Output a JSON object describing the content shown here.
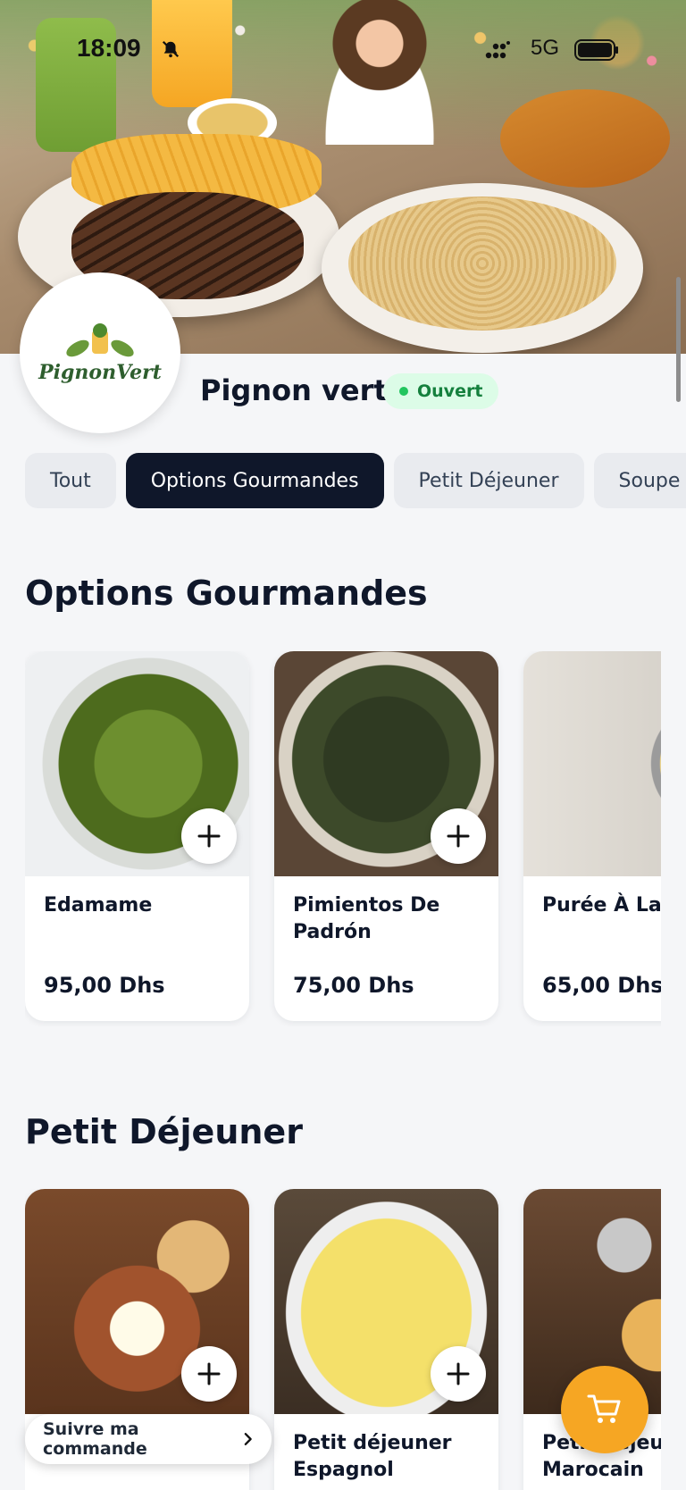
{
  "status_bar": {
    "time": "18:09",
    "network": "5G",
    "icons": [
      "bell-muted-icon",
      "signal-icon",
      "battery-icon"
    ]
  },
  "restaurant": {
    "logo_text": "PignonVert",
    "name": "Pignon vert",
    "status": "Ouvert",
    "status_color": "#22c55e"
  },
  "tabs": [
    {
      "label": "Tout",
      "active": false
    },
    {
      "label": "Options Gourmandes",
      "active": true
    },
    {
      "label": "Petit Déjeuner",
      "active": false
    },
    {
      "label": "Soupe",
      "active": false
    }
  ],
  "sections": [
    {
      "title": "Options Gourmandes",
      "items": [
        {
          "name": "Edamame",
          "price": "95,00 Dhs"
        },
        {
          "name": "Pimientos De Padrón",
          "price": "75,00 Dhs"
        },
        {
          "name": "Purée À La T",
          "price": "65,00 Dhs"
        }
      ]
    },
    {
      "title": "Petit Déjeuner",
      "items": [
        {
          "name": "",
          "price": ""
        },
        {
          "name": "Petit déjeuner Espagnol",
          "price": ""
        },
        {
          "name": "Petit déjeun Marocain",
          "price": ""
        }
      ]
    }
  ],
  "floating": {
    "track_order_label": "Suivre ma commande",
    "cart_icon": "cart-icon",
    "accent_color": "#f6a623"
  }
}
